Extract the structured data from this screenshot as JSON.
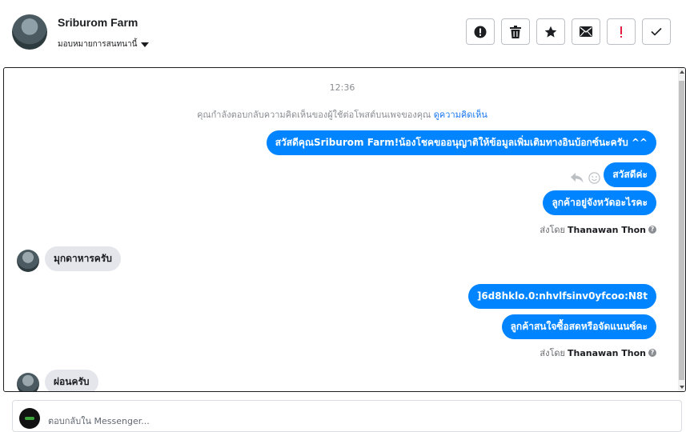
{
  "header": {
    "name": "Sriburom Farm",
    "assign_label": "มอบหมายการสนทนานี้"
  },
  "toolbar": [
    {
      "name": "mark-spam-button",
      "icon": "alert-circle-icon"
    },
    {
      "name": "delete-button",
      "icon": "trash-icon"
    },
    {
      "name": "star-button",
      "icon": "star-icon"
    },
    {
      "name": "mark-unread-button",
      "icon": "envelope-icon"
    },
    {
      "name": "follow-up-button",
      "icon": "exclamation-icon"
    },
    {
      "name": "mark-done-button",
      "icon": "check-icon"
    }
  ],
  "conversation": {
    "time": "12:36",
    "notice": "คุณกำลังตอบกลับความคิดเห็นของผู้ใช้ต่อโพสต์บนเพจของคุณ",
    "notice_link": "ดูความคิดเห็น",
    "messages": [
      {
        "from": "page",
        "text": "สวัสดีคุณSriburom Farm!น้องโชคขออนุญาติให้ข้อมูลเพิ่มเติมทางอินบ้อกซ์นะครับ ^^"
      },
      {
        "from": "page",
        "text": "สวัสดีค่ะ"
      },
      {
        "from": "page",
        "text": "ลูกค้าอยู่จังหวัดอะไรคะ"
      },
      {
        "from": "user",
        "text": "มุกดาหารครับ"
      },
      {
        "from": "page",
        "text": "]6d8hklo.0:nhvlfsinv0yfcoo:N8t"
      },
      {
        "from": "page",
        "text": "ลูกค้าสนใจซื้อสดหรือจัดแนนซ์คะ"
      },
      {
        "from": "user",
        "text": "ผ่อนครับ"
      }
    ],
    "sent_by_label": "ส่งโดย",
    "sent_by_name": "Thanawan Thon"
  },
  "reply": {
    "placeholder": "ตอบกลับใน Messenger..."
  },
  "colors": {
    "accent": "#0084ff",
    "incoming_bubble": "#e4e6eb",
    "link": "#1877f2"
  }
}
